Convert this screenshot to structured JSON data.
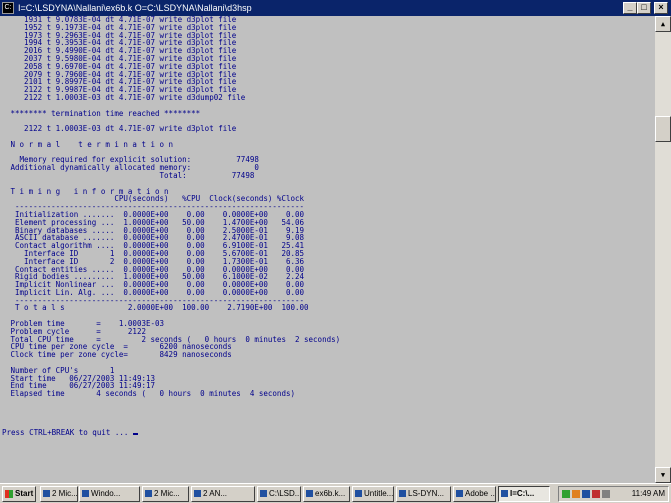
{
  "window": {
    "title": "I=C:\\LSDYNA\\Nallani\\ex6b.k O=C:\\LSDYNA\\Nallani\\d3hsp",
    "icon": "c-prompt-icon",
    "minimize_label": "_",
    "maximize_label": "□",
    "close_label": "×"
  },
  "console": {
    "lines": [
      "    1931 t 9.0783E-04 dt 4.71E-07 write d3plot file",
      "    1952 t 9.1973E-04 dt 4.71E-07 write d3plot file",
      "    1973 t 9.2963E-04 dt 4.71E-07 write d3plot file",
      "    1994 t 9.3953E-04 dt 4.71E-07 write d3plot file",
      "    2016 t 9.4990E-04 dt 4.71E-07 write d3plot file",
      "    2037 t 9.5980E-04 dt 4.71E-07 write d3plot file",
      "    2058 t 9.6970E-04 dt 4.71E-07 write d3plot file",
      "    2079 t 9.7960E-04 dt 4.71E-07 write d3plot file",
      "    2101 t 9.8997E-04 dt 4.71E-07 write d3plot file",
      "    2122 t 9.9987E-04 dt 4.71E-07 write d3plot file",
      "    2122 t 1.0003E-03 dt 4.71E-07 write d3dump02 file",
      "",
      " ******** termination time reached ********",
      "",
      "    2122 t 1.0003E-03 dt 4.71E-07 write d3plot file",
      "",
      " N o r m a l    t e r m i n a t i o n",
      "",
      "   Memory required for explicit solution:          77498",
      " Additional dynamically allocated memory:              0",
      "                                  Total:          77498",
      "",
      " T i m i n g   i n f o r m a t i o n",
      "                        CPU(seconds)   %CPU  Clock(seconds) %Clock",
      "  ----------------------------------------------------------------",
      "  Initialization .......  0.0000E+00    0.00    0.0000E+00    0.00",
      "  Element processing ...  1.0000E+00   50.00    1.4700E+00   54.06",
      "  Binary databases .....  0.0000E+00    0.00    2.5000E-01    9.19",
      "  ASCII database .......  0.0000E+00    0.00    2.4700E-01    9.08",
      "  Contact algorithm ....  0.0000E+00    0.00    6.9100E-01   25.41",
      "    Interface ID       1  0.0000E+00    0.00    5.6700E-01   20.85",
      "    Interface ID       2  0.0000E+00    0.00    1.7300E-01    6.36",
      "  Contact entities .....  0.0000E+00    0.00    0.0000E+00    0.00",
      "  Rigid bodies .........  1.0000E+00   50.00    6.1000E-02    2.24",
      "  Implicit Nonlinear ...  0.0000E+00    0.00    0.0000E+00    0.00",
      "  Implicit Lin. Alg. ...  0.0000E+00    0.00    0.0000E+00    0.00",
      "  ----------------------------------------------------------------",
      "  T o t a l s              2.0000E+00  100.00    2.7190E+00  100.00",
      "",
      " Problem time       =    1.0003E-03",
      " Problem cycle      =      2122",
      " Total CPU time     =         2 seconds (   0 hours  0 minutes  2 seconds)",
      " CPU time per zone cycle  =       6200 nanoseconds",
      " Clock time per zone cycle=       8429 nanoseconds",
      "",
      " Number of CPU's       1",
      " Start time   06/27/2003 11:49:13",
      " End time     06/27/2003 11:49:17",
      " Elapsed time       4 seconds (   0 hours  0 minutes  4 seconds)"
    ],
    "prompt": "Press CTRL+BREAK to quit ... "
  },
  "scrollbar": {
    "up_label": "▲",
    "down_label": "▼"
  },
  "taskbar": {
    "start_label": "Start",
    "tasks": [
      {
        "label": "2 Mic...",
        "active": false
      },
      {
        "label": "Windo...",
        "active": false
      },
      {
        "label": "2 Mic...",
        "active": false
      },
      {
        "label": "2 AN...",
        "active": false
      },
      {
        "label": "C:\\LSD...",
        "active": false
      },
      {
        "label": "ex6b.k...",
        "active": false
      },
      {
        "label": "Untitle...",
        "active": false
      },
      {
        "label": "LS-DYN...",
        "active": false
      },
      {
        "label": "Adobe ...",
        "active": false
      },
      {
        "label": "I=C:\\...",
        "active": true
      }
    ],
    "clock": "11:49 AM"
  }
}
